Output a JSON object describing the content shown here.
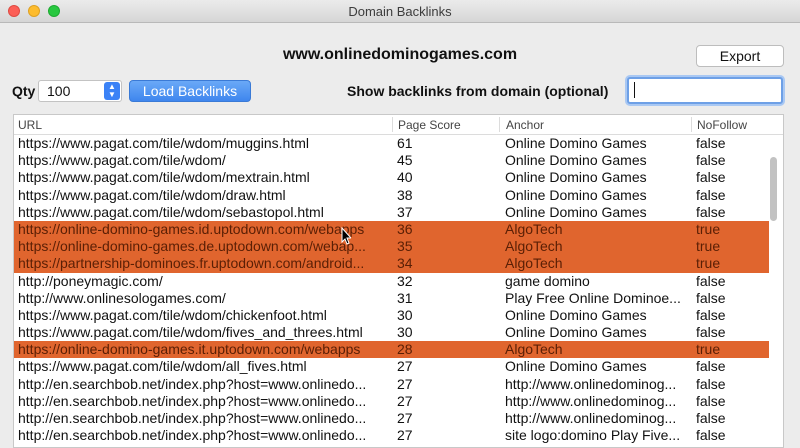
{
  "window": {
    "title": "Domain Backlinks"
  },
  "header": {
    "domain": "www.onlinedominogames.com",
    "export_label": "Export"
  },
  "controls": {
    "qty_label": "Qty",
    "qty_value": "100",
    "load_label": "Load Backlinks",
    "show_label": "Show backlinks from domain (optional)",
    "domain_value": ""
  },
  "table": {
    "columns": [
      "URL",
      "Page Score",
      "Anchor",
      "NoFollow"
    ],
    "rows": [
      {
        "url": "https://www.pagat.com/tile/wdom/muggins.html",
        "score": "61",
        "anchor": "Online Domino Games",
        "nofollow": "false",
        "highlighted": false
      },
      {
        "url": "https://www.pagat.com/tile/wdom/",
        "score": "45",
        "anchor": "Online Domino Games",
        "nofollow": "false",
        "highlighted": false
      },
      {
        "url": "https://www.pagat.com/tile/wdom/mextrain.html",
        "score": "40",
        "anchor": "Online Domino Games",
        "nofollow": "false",
        "highlighted": false
      },
      {
        "url": "https://www.pagat.com/tile/wdom/draw.html",
        "score": "38",
        "anchor": "Online Domino Games",
        "nofollow": "false",
        "highlighted": false
      },
      {
        "url": "https://www.pagat.com/tile/wdom/sebastopol.html",
        "score": "37",
        "anchor": "Online Domino Games",
        "nofollow": "false",
        "highlighted": false
      },
      {
        "url": "https://online-domino-games.id.uptodown.com/webapps",
        "score": "36",
        "anchor": "AlgoTech",
        "nofollow": "true",
        "highlighted": true
      },
      {
        "url": "https://online-domino-games.de.uptodown.com/webap...",
        "score": "35",
        "anchor": "AlgoTech",
        "nofollow": "true",
        "highlighted": true
      },
      {
        "url": "https://partnership-dominoes.fr.uptodown.com/android...",
        "score": "34",
        "anchor": "AlgoTech",
        "nofollow": "true",
        "highlighted": true
      },
      {
        "url": "http://poneymagic.com/",
        "score": "32",
        "anchor": "game domino",
        "nofollow": "false",
        "highlighted": false
      },
      {
        "url": "http://www.onlinesologames.com/",
        "score": "31",
        "anchor": "Play Free Online Dominoe...",
        "nofollow": "false",
        "highlighted": false
      },
      {
        "url": "https://www.pagat.com/tile/wdom/chickenfoot.html",
        "score": "30",
        "anchor": "Online Domino Games",
        "nofollow": "false",
        "highlighted": false
      },
      {
        "url": "https://www.pagat.com/tile/wdom/fives_and_threes.html",
        "score": "30",
        "anchor": "Online Domino Games",
        "nofollow": "false",
        "highlighted": false
      },
      {
        "url": "https://online-domino-games.it.uptodown.com/webapps",
        "score": "28",
        "anchor": "AlgoTech",
        "nofollow": "true",
        "highlighted": true
      },
      {
        "url": "https://www.pagat.com/tile/wdom/all_fives.html",
        "score": "27",
        "anchor": "Online Domino Games",
        "nofollow": "false",
        "highlighted": false
      },
      {
        "url": "http://en.searchbob.net/index.php?host=www.onlinedo...",
        "score": "27",
        "anchor": "http://www.onlinedominog...",
        "nofollow": "false",
        "highlighted": false
      },
      {
        "url": "http://en.searchbob.net/index.php?host=www.onlinedo...",
        "score": "27",
        "anchor": "http://www.onlinedominog...",
        "nofollow": "false",
        "highlighted": false
      },
      {
        "url": "http://en.searchbob.net/index.php?host=www.onlinedo...",
        "score": "27",
        "anchor": "http://www.onlinedominog...",
        "nofollow": "false",
        "highlighted": false
      },
      {
        "url": "http://en.searchbob.net/index.php?host=www.onlinedo...",
        "score": "27",
        "anchor": "site logo:domino Play Five...",
        "nofollow": "false",
        "highlighted": false
      }
    ]
  },
  "colors": {
    "highlight_row": "#e0652e",
    "accent": "#3f86ee"
  }
}
